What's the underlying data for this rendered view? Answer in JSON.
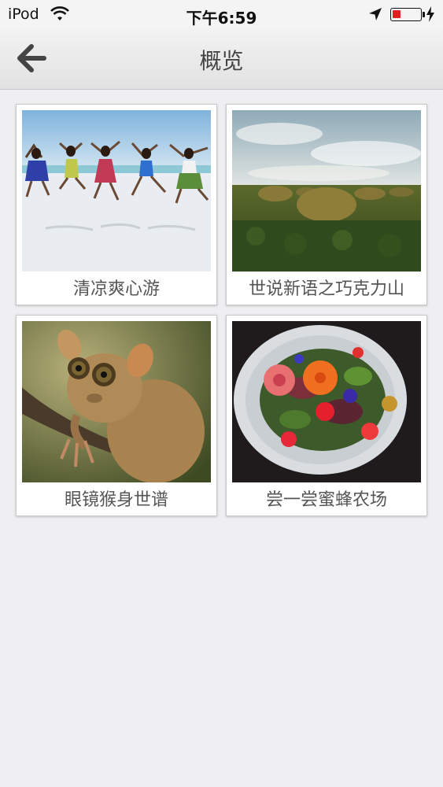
{
  "status_bar": {
    "carrier": "iPod",
    "time": "下午6:59",
    "battery_level": 0.3,
    "battery_color": "#e02020"
  },
  "nav": {
    "title": "概览",
    "back_icon": "arrow-left-icon"
  },
  "cards": [
    {
      "caption": "清凉爽心游",
      "image": "beach-jumping-photo"
    },
    {
      "caption": "世说新语之巧克力山",
      "image": "chocolate-hills-photo"
    },
    {
      "caption": "眼镜猴身世谱",
      "image": "tarsier-photo"
    },
    {
      "caption": "尝一尝蜜蜂农场",
      "image": "flower-salad-photo"
    }
  ]
}
